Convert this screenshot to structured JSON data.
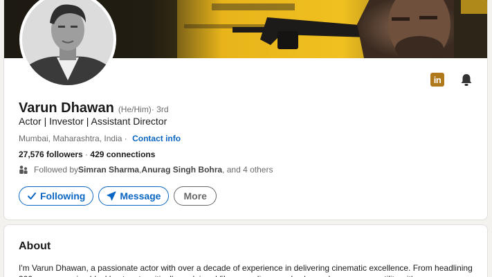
{
  "profile": {
    "name": "Varun Dhawan",
    "pronouns": "(He/Him)",
    "degree": " · 3rd",
    "headline": "Actor | Investor | Assistant Director",
    "location": "Mumbai, Maharashtra, India ·",
    "contact_label": "Contact info",
    "followers": "27,576 followers",
    "separator": " · ",
    "connections": "429 connections",
    "followed_prefix": "Followed by ",
    "followed_person_1": "Simran Sharma",
    "followed_sep": ", ",
    "followed_person_2": "Anurag Singh Bohra",
    "followed_suffix": ", and 4 others"
  },
  "actions": {
    "following_label": "Following",
    "message_label": "Message",
    "more_label": "More"
  },
  "icons": {
    "linkedin_text": "in",
    "linkedin": "linkedin-icon",
    "bell": "bell-icon",
    "check": "check-icon",
    "send": "send-icon",
    "people": "people-icon"
  },
  "about": {
    "title": "About",
    "text": "I'm Varun Dhawan, a passionate actor with over a decade of experience in delivering cinematic excellence. From headlining 300 crore grossing blockbusters to critically acclaimed films, my diverse roles have shown my versatility with"
  },
  "colors": {
    "accent": "#0a66c2",
    "banner_yellow": "#e8b41a",
    "linkedin_badge": "#b07a1c"
  }
}
